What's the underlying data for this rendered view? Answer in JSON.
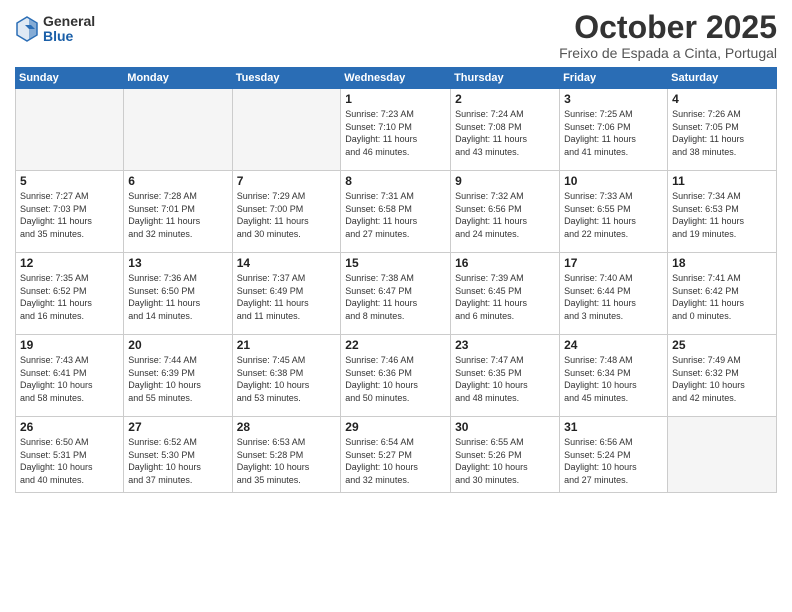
{
  "header": {
    "logo": {
      "general": "General",
      "blue": "Blue"
    },
    "title": "October 2025",
    "subtitle": "Freixo de Espada a Cinta, Portugal"
  },
  "days_of_week": [
    "Sunday",
    "Monday",
    "Tuesday",
    "Wednesday",
    "Thursday",
    "Friday",
    "Saturday"
  ],
  "weeks": [
    [
      {
        "day": "",
        "info": ""
      },
      {
        "day": "",
        "info": ""
      },
      {
        "day": "",
        "info": ""
      },
      {
        "day": "1",
        "info": "Sunrise: 7:23 AM\nSunset: 7:10 PM\nDaylight: 11 hours\nand 46 minutes."
      },
      {
        "day": "2",
        "info": "Sunrise: 7:24 AM\nSunset: 7:08 PM\nDaylight: 11 hours\nand 43 minutes."
      },
      {
        "day": "3",
        "info": "Sunrise: 7:25 AM\nSunset: 7:06 PM\nDaylight: 11 hours\nand 41 minutes."
      },
      {
        "day": "4",
        "info": "Sunrise: 7:26 AM\nSunset: 7:05 PM\nDaylight: 11 hours\nand 38 minutes."
      }
    ],
    [
      {
        "day": "5",
        "info": "Sunrise: 7:27 AM\nSunset: 7:03 PM\nDaylight: 11 hours\nand 35 minutes."
      },
      {
        "day": "6",
        "info": "Sunrise: 7:28 AM\nSunset: 7:01 PM\nDaylight: 11 hours\nand 32 minutes."
      },
      {
        "day": "7",
        "info": "Sunrise: 7:29 AM\nSunset: 7:00 PM\nDaylight: 11 hours\nand 30 minutes."
      },
      {
        "day": "8",
        "info": "Sunrise: 7:31 AM\nSunset: 6:58 PM\nDaylight: 11 hours\nand 27 minutes."
      },
      {
        "day": "9",
        "info": "Sunrise: 7:32 AM\nSunset: 6:56 PM\nDaylight: 11 hours\nand 24 minutes."
      },
      {
        "day": "10",
        "info": "Sunrise: 7:33 AM\nSunset: 6:55 PM\nDaylight: 11 hours\nand 22 minutes."
      },
      {
        "day": "11",
        "info": "Sunrise: 7:34 AM\nSunset: 6:53 PM\nDaylight: 11 hours\nand 19 minutes."
      }
    ],
    [
      {
        "day": "12",
        "info": "Sunrise: 7:35 AM\nSunset: 6:52 PM\nDaylight: 11 hours\nand 16 minutes."
      },
      {
        "day": "13",
        "info": "Sunrise: 7:36 AM\nSunset: 6:50 PM\nDaylight: 11 hours\nand 14 minutes."
      },
      {
        "day": "14",
        "info": "Sunrise: 7:37 AM\nSunset: 6:49 PM\nDaylight: 11 hours\nand 11 minutes."
      },
      {
        "day": "15",
        "info": "Sunrise: 7:38 AM\nSunset: 6:47 PM\nDaylight: 11 hours\nand 8 minutes."
      },
      {
        "day": "16",
        "info": "Sunrise: 7:39 AM\nSunset: 6:45 PM\nDaylight: 11 hours\nand 6 minutes."
      },
      {
        "day": "17",
        "info": "Sunrise: 7:40 AM\nSunset: 6:44 PM\nDaylight: 11 hours\nand 3 minutes."
      },
      {
        "day": "18",
        "info": "Sunrise: 7:41 AM\nSunset: 6:42 PM\nDaylight: 11 hours\nand 0 minutes."
      }
    ],
    [
      {
        "day": "19",
        "info": "Sunrise: 7:43 AM\nSunset: 6:41 PM\nDaylight: 10 hours\nand 58 minutes."
      },
      {
        "day": "20",
        "info": "Sunrise: 7:44 AM\nSunset: 6:39 PM\nDaylight: 10 hours\nand 55 minutes."
      },
      {
        "day": "21",
        "info": "Sunrise: 7:45 AM\nSunset: 6:38 PM\nDaylight: 10 hours\nand 53 minutes."
      },
      {
        "day": "22",
        "info": "Sunrise: 7:46 AM\nSunset: 6:36 PM\nDaylight: 10 hours\nand 50 minutes."
      },
      {
        "day": "23",
        "info": "Sunrise: 7:47 AM\nSunset: 6:35 PM\nDaylight: 10 hours\nand 48 minutes."
      },
      {
        "day": "24",
        "info": "Sunrise: 7:48 AM\nSunset: 6:34 PM\nDaylight: 10 hours\nand 45 minutes."
      },
      {
        "day": "25",
        "info": "Sunrise: 7:49 AM\nSunset: 6:32 PM\nDaylight: 10 hours\nand 42 minutes."
      }
    ],
    [
      {
        "day": "26",
        "info": "Sunrise: 6:50 AM\nSunset: 5:31 PM\nDaylight: 10 hours\nand 40 minutes."
      },
      {
        "day": "27",
        "info": "Sunrise: 6:52 AM\nSunset: 5:30 PM\nDaylight: 10 hours\nand 37 minutes."
      },
      {
        "day": "28",
        "info": "Sunrise: 6:53 AM\nSunset: 5:28 PM\nDaylight: 10 hours\nand 35 minutes."
      },
      {
        "day": "29",
        "info": "Sunrise: 6:54 AM\nSunset: 5:27 PM\nDaylight: 10 hours\nand 32 minutes."
      },
      {
        "day": "30",
        "info": "Sunrise: 6:55 AM\nSunset: 5:26 PM\nDaylight: 10 hours\nand 30 minutes."
      },
      {
        "day": "31",
        "info": "Sunrise: 6:56 AM\nSunset: 5:24 PM\nDaylight: 10 hours\nand 27 minutes."
      },
      {
        "day": "",
        "info": ""
      }
    ]
  ]
}
